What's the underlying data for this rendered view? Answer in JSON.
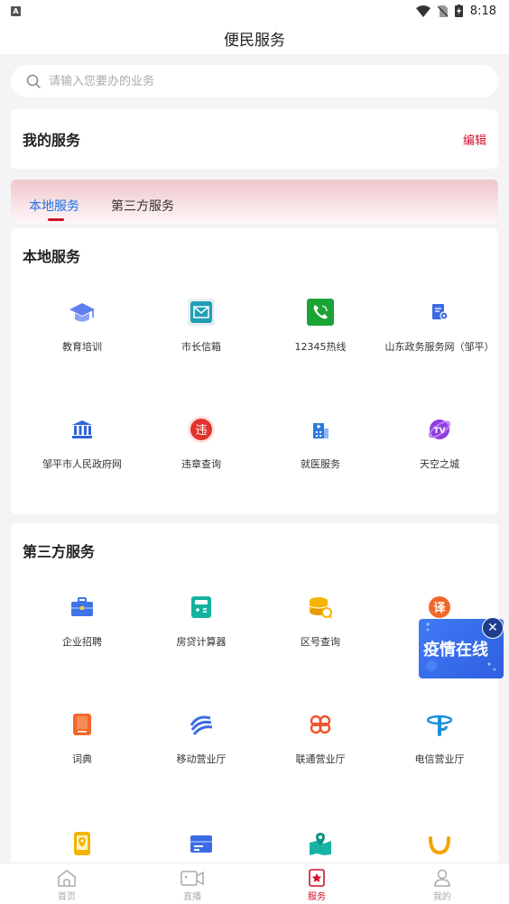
{
  "status_bar": {
    "time": "8:18"
  },
  "header": {
    "title": "便民服务"
  },
  "search": {
    "placeholder": "请输入您要办的业务"
  },
  "my_services": {
    "title": "我的服务",
    "edit_label": "编辑"
  },
  "tabs": [
    {
      "label": "本地服务",
      "active": true
    },
    {
      "label": "第三方服务",
      "active": false
    }
  ],
  "local_services": {
    "title": "本地服务",
    "items": [
      {
        "label": "教育培训",
        "icon": "graduation-cap-icon"
      },
      {
        "label": "市长信箱",
        "icon": "mail-icon"
      },
      {
        "label": "12345热线",
        "icon": "phone-icon"
      },
      {
        "label": "山东政务服务网（邹平）",
        "icon": "government-doc-icon"
      },
      {
        "label": "邹平市人民政府网",
        "icon": "government-building-icon"
      },
      {
        "label": "违章查询",
        "icon": "violation-icon"
      },
      {
        "label": "就医服务",
        "icon": "hospital-icon"
      },
      {
        "label": "天空之城",
        "icon": "tv-icon"
      }
    ]
  },
  "third_party_services": {
    "title": "第三方服务",
    "items": [
      {
        "label": "企业招聘",
        "icon": "briefcase-icon"
      },
      {
        "label": "房贷计算器",
        "icon": "calculator-icon"
      },
      {
        "label": "区号查询",
        "icon": "area-code-icon"
      },
      {
        "label": "",
        "icon": "translate-icon"
      },
      {
        "label": "词典",
        "icon": "dictionary-icon"
      },
      {
        "label": "移动营业厅",
        "icon": "china-mobile-icon"
      },
      {
        "label": "联通营业厅",
        "icon": "china-unicom-icon"
      },
      {
        "label": "电信营业厅",
        "icon": "china-telecom-icon"
      },
      {
        "label": "",
        "icon": "phone-location-icon"
      },
      {
        "label": "",
        "icon": "package-icon"
      },
      {
        "label": "",
        "icon": "map-pin-icon"
      },
      {
        "label": "",
        "icon": "didi-icon"
      }
    ]
  },
  "floating_badge": {
    "text": "疫情在线"
  },
  "bottom_nav": [
    {
      "label": "首页",
      "icon": "home-icon",
      "active": false
    },
    {
      "label": "直播",
      "icon": "video-camera-icon",
      "active": false
    },
    {
      "label": "服务",
      "icon": "service-star-icon",
      "active": true
    },
    {
      "label": "我的",
      "icon": "user-icon",
      "active": false
    }
  ],
  "colors": {
    "accent": "#d0112b",
    "active_tab": "#1a72e8",
    "background": "#f4f4f6"
  }
}
